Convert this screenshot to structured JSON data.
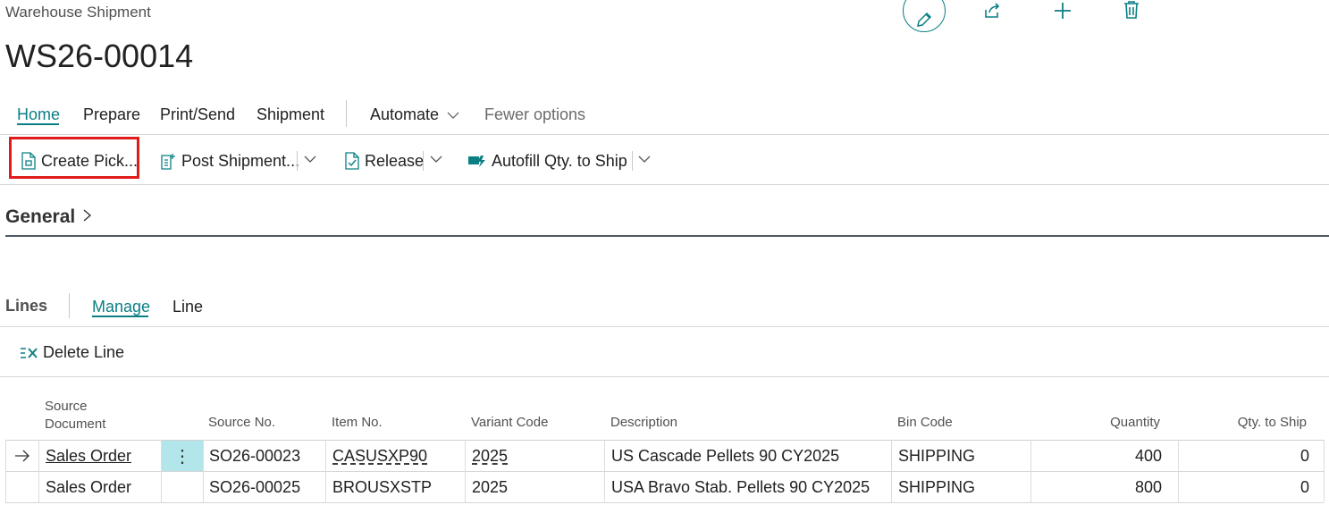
{
  "header": {
    "caption": "Warehouse Shipment",
    "title": "WS26-00014"
  },
  "top_actions": {
    "edit_icon": "pencil-icon",
    "share_icon": "share-icon",
    "new_icon": "plus-icon",
    "delete_icon": "trash-icon"
  },
  "menu": {
    "home": "Home",
    "prepare": "Prepare",
    "print_send": "Print/Send",
    "shipment": "Shipment",
    "automate": "Automate",
    "fewer_options": "Fewer options"
  },
  "toolbar": {
    "create_pick": "Create Pick...",
    "post_shipment": "Post Shipment...",
    "release": "Release",
    "autofill": "Autofill Qty. to Ship"
  },
  "general": {
    "label": "General"
  },
  "lines": {
    "label": "Lines",
    "tab_manage": "Manage",
    "tab_line": "Line",
    "delete_line": "Delete Line",
    "columns": {
      "source_document_1": "Source",
      "source_document_2": "Document",
      "source_no": "Source No.",
      "item_no": "Item No.",
      "variant_code": "Variant Code",
      "description": "Description",
      "bin_code": "Bin Code",
      "quantity": "Quantity",
      "qty_to_ship": "Qty. to Ship"
    },
    "rows": [
      {
        "source_document": "Sales Order",
        "source_no": "SO26-00023",
        "item_no": "CASUSXP90",
        "variant_code": "2025",
        "description": "US Cascade Pellets 90 CY2025",
        "bin_code": "SHIPPING",
        "quantity": "400",
        "qty_to_ship": "0"
      },
      {
        "source_document": "Sales Order",
        "source_no": "SO26-00025",
        "item_no": "BROUSXSTP",
        "variant_code": "2025",
        "description": "USA Bravo Stab. Pellets 90 CY2025",
        "bin_code": "SHIPPING",
        "quantity": "800",
        "qty_to_ship": "0"
      }
    ]
  },
  "colors": {
    "accent": "#0b7f84",
    "highlight": "#e01b1b",
    "selected_cell": "#b2e6ea"
  }
}
